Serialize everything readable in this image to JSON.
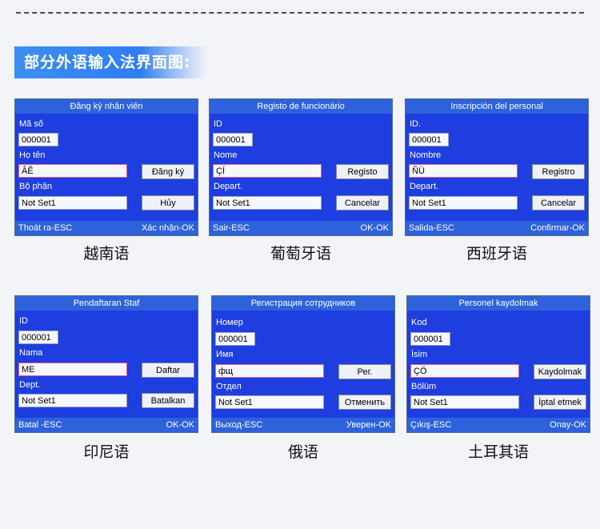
{
  "heading": "部分外语输入法界面图:",
  "panels": [
    {
      "title": "Đăng ký nhân viên",
      "id_label": "Mã số",
      "id_value": "000001",
      "name_label": "Họ tên",
      "name_value": "ÂÊ",
      "dept_label": "Bộ phận",
      "dept_value": "Not Set1",
      "register_button": "Đăng ký",
      "cancel_button": "Hủy",
      "footer_left": "Thoát ra-ESC",
      "footer_right": "Xác nhận-OK",
      "caption": "越南语"
    },
    {
      "title": "Registo de funcionário",
      "id_label": "ID",
      "id_value": "000001",
      "name_label": "Nome",
      "name_value": "ÇÍ",
      "dept_label": "Depart.",
      "dept_value": "Not Set1",
      "register_button": "Registo",
      "cancel_button": "Cancelar",
      "footer_left": "Sair-ESC",
      "footer_right": "OK-OK",
      "caption": "葡萄牙语"
    },
    {
      "title": "Inscripción del personal",
      "id_label": "ID.",
      "id_value": "000001",
      "name_label": "Nombre",
      "name_value": "ÑÜ",
      "dept_label": "Depart.",
      "dept_value": "Not Set1",
      "register_button": "Registro",
      "cancel_button": "Cancelar",
      "footer_left": "Salida-ESC",
      "footer_right": "Confirmar-OK",
      "caption": "西班牙语"
    },
    {
      "title": "Pendaftaran Staf",
      "id_label": "ID",
      "id_value": "000001",
      "name_label": "Nama",
      "name_value": "ME",
      "dept_label": "Dept.",
      "dept_value": "Not Set1",
      "register_button": "Daftar",
      "cancel_button": "Batalkan",
      "footer_left": "Batal -ESC",
      "footer_right": "OK-OK",
      "caption": "印尼语"
    },
    {
      "title": "Регистрация сотрудников",
      "id_label": "Номер",
      "id_value": "000001",
      "name_label": "Имя",
      "name_value": "фщ",
      "dept_label": "Отдел",
      "dept_value": "Not Set1",
      "register_button": "Рег.",
      "cancel_button": "Отменить",
      "footer_left": "Выход-ESC",
      "footer_right": "Уверен-OK",
      "caption": "俄语"
    },
    {
      "title": "Personel kaydolmak",
      "id_label": "Kod",
      "id_value": "000001",
      "name_label": "İsim",
      "name_value": "ÇÖ",
      "dept_label": "Bölüm",
      "dept_value": "Not Set1",
      "register_button": "Kaydolmak",
      "cancel_button": "İptal etmek",
      "footer_left": "Çıkış-ESC",
      "footer_right": "Onay-OK",
      "caption": "土耳其语"
    }
  ]
}
